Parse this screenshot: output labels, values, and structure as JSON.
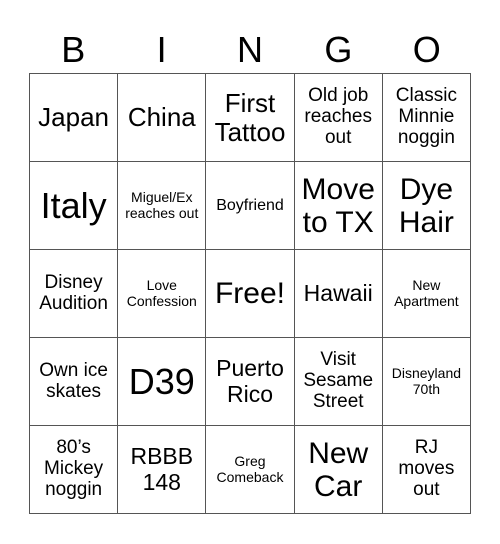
{
  "header": {
    "letters": [
      "B",
      "I",
      "N",
      "G",
      "O"
    ]
  },
  "cells": [
    [
      "Japan",
      "China",
      "First Tattoo",
      "Old job reaches out",
      "Classic Minnie noggin"
    ],
    [
      "Italy",
      "Miguel/Ex reaches out",
      "Boyfriend",
      "Move to TX",
      "Dye Hair"
    ],
    [
      "Disney Audition",
      "Love Confession",
      "Free!",
      "Hawaii",
      "New Apartment"
    ],
    [
      "Own ice skates",
      "D39",
      "Puerto Rico",
      "Visit Sesame Street",
      "Disneyland 70th"
    ],
    [
      "80’s Mickey noggin",
      "RBBB 148",
      "Greg Comeback",
      "New Car",
      "RJ moves out"
    ]
  ]
}
